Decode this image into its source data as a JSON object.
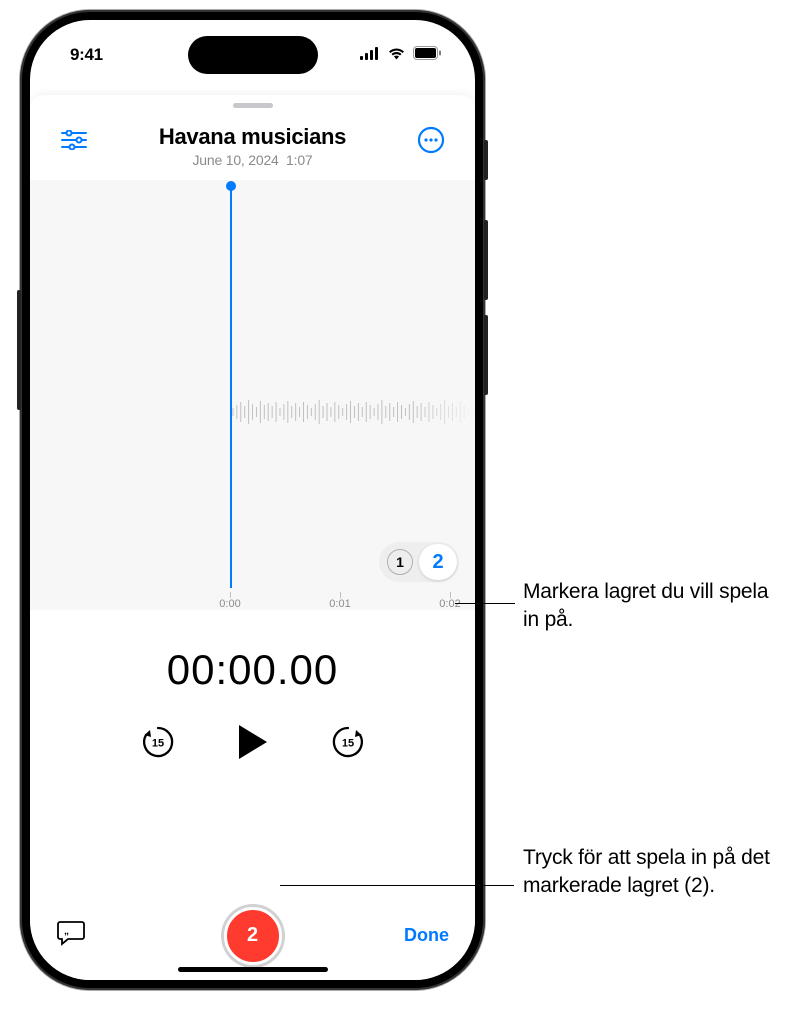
{
  "status": {
    "time": "9:41"
  },
  "header": {
    "title": "Havana musicians",
    "date": "June 10, 2024",
    "duration": "1:07"
  },
  "waveform": {
    "ticks": [
      "0:00",
      "0:01",
      "0:02"
    ]
  },
  "layers": {
    "options": [
      "1",
      "2"
    ],
    "selected": "2"
  },
  "timer": "00:00.00",
  "skip_amount": "15",
  "record": {
    "layer_badge": "2"
  },
  "bottom": {
    "done": "Done"
  },
  "callouts": {
    "layer": "Markera lagret du vill spela in på.",
    "record": "Tryck för att spela in på det markerade lagret (2)."
  }
}
